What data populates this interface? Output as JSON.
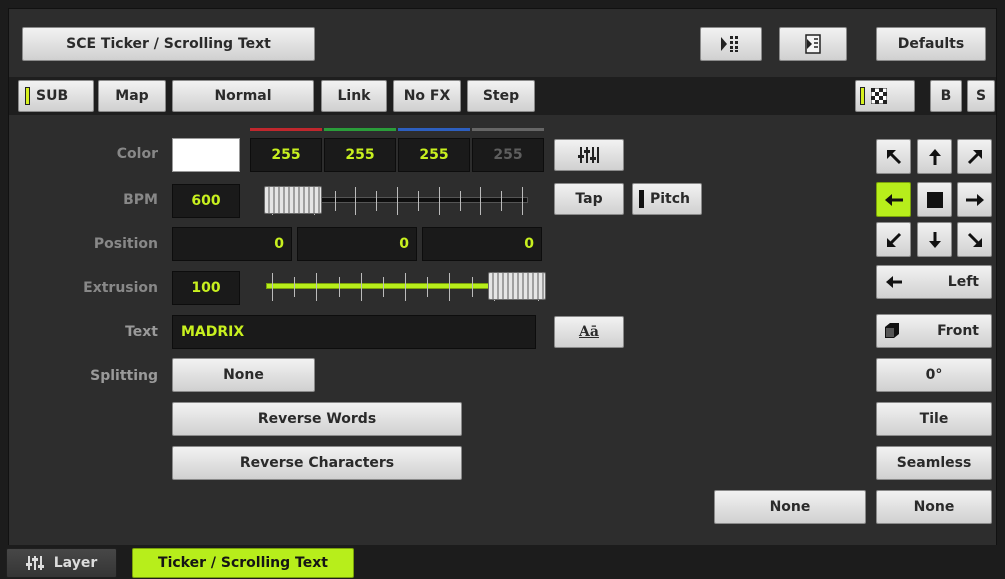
{
  "header": {
    "title": "SCE Ticker / Scrolling Text",
    "defaults_label": "Defaults"
  },
  "toolbar": {
    "sub_label": "SUB",
    "map_label": "Map",
    "blend_label": "Normal",
    "link_label": "Link",
    "nofx_label": "No FX",
    "step_label": "Step",
    "b_label": "B",
    "s_label": "S"
  },
  "rows": {
    "color_label": "Color",
    "color_swatch": "#ffffff",
    "color_values": [
      "255",
      "255",
      "255",
      "255"
    ],
    "bpm_label": "BPM",
    "bpm_value": "600",
    "bpm_slider_fraction": 0.0,
    "tap_label": "Tap",
    "pitch_label": "Pitch",
    "position_label": "Position",
    "position_values": [
      "0",
      "0",
      "0"
    ],
    "extrusion_label": "Extrusion",
    "extrusion_value": "100",
    "extrusion_slider_fraction": 1.0,
    "text_label": "Text",
    "text_value": "MADRIX",
    "font_button_label": "Aā",
    "splitting_label": "Splitting",
    "splitting_value": "None",
    "reverse_words_label": "Reverse Words",
    "reverse_chars_label": "Reverse Characters"
  },
  "direction": {
    "selected": "left",
    "dir_label": "Left",
    "look_label": "Front",
    "angle_label": "0°",
    "tile_label": "Tile",
    "seamless_label": "Seamless",
    "none_a_label": "None",
    "none_b_label": "None"
  },
  "footer": {
    "layer_label": "Layer",
    "effect_tab_label": "Ticker / Scrolling Text"
  },
  "colors": {
    "accent": "#b7ee1b",
    "red_bar": "#c0272d",
    "green_bar": "#2a9d3a",
    "blue_bar": "#2d5fbf"
  }
}
